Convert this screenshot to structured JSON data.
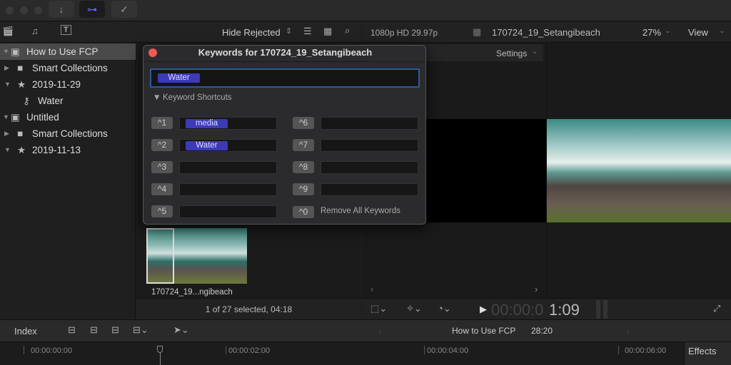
{
  "toolbar": {
    "icons": [
      "import-icon",
      "keyword-icon",
      "background-tasks-icon"
    ]
  },
  "browser_header": {
    "filter": "Hide Rejected"
  },
  "viewer_header": {
    "format": "1080p HD 29.97p",
    "clip_name": "170724_19_Setangibeach",
    "zoom": "27%",
    "view": "View"
  },
  "sidebar": {
    "items": [
      {
        "label": "How to Use FCP",
        "type": "library",
        "selected": true
      },
      {
        "label": "Smart Collections",
        "type": "folder"
      },
      {
        "label": "2019-11-29",
        "type": "event"
      },
      {
        "label": "Water",
        "type": "keyword"
      },
      {
        "label": "Untitled",
        "type": "library"
      },
      {
        "label": "Smart Collections",
        "type": "folder"
      },
      {
        "label": "2019-11-13",
        "type": "event"
      }
    ]
  },
  "dialog": {
    "title": "Keywords for 170724_19_Setangibeach",
    "keyword_tag": "Water",
    "section": "Keyword Shortcuts",
    "shortcuts": [
      {
        "key": "^1",
        "keyword": "media"
      },
      {
        "key": "^2",
        "keyword": "Water"
      },
      {
        "key": "^3",
        "keyword": ""
      },
      {
        "key": "^4",
        "keyword": ""
      },
      {
        "key": "^5",
        "keyword": ""
      },
      {
        "key": "^6",
        "keyword": ""
      },
      {
        "key": "^7",
        "keyword": ""
      },
      {
        "key": "^8",
        "keyword": ""
      },
      {
        "key": "^9",
        "keyword": ""
      }
    ],
    "remove_key": "^0",
    "remove_label": "Remove All Keywords"
  },
  "browser": {
    "clip_label": "170724_19...ngibeach",
    "status": "1 of 27 selected, 04:18"
  },
  "viewer": {
    "settings": "Settings",
    "timecode_dim": "00:00:0",
    "timecode": "1:09"
  },
  "timeline": {
    "index": "Index",
    "project": "How to Use FCP",
    "duration": "28:20",
    "ruler": [
      "00:00:00:00",
      "00:00:02:00",
      "00:00:04:00",
      "00:00:06:00"
    ],
    "effects": "Effects"
  }
}
